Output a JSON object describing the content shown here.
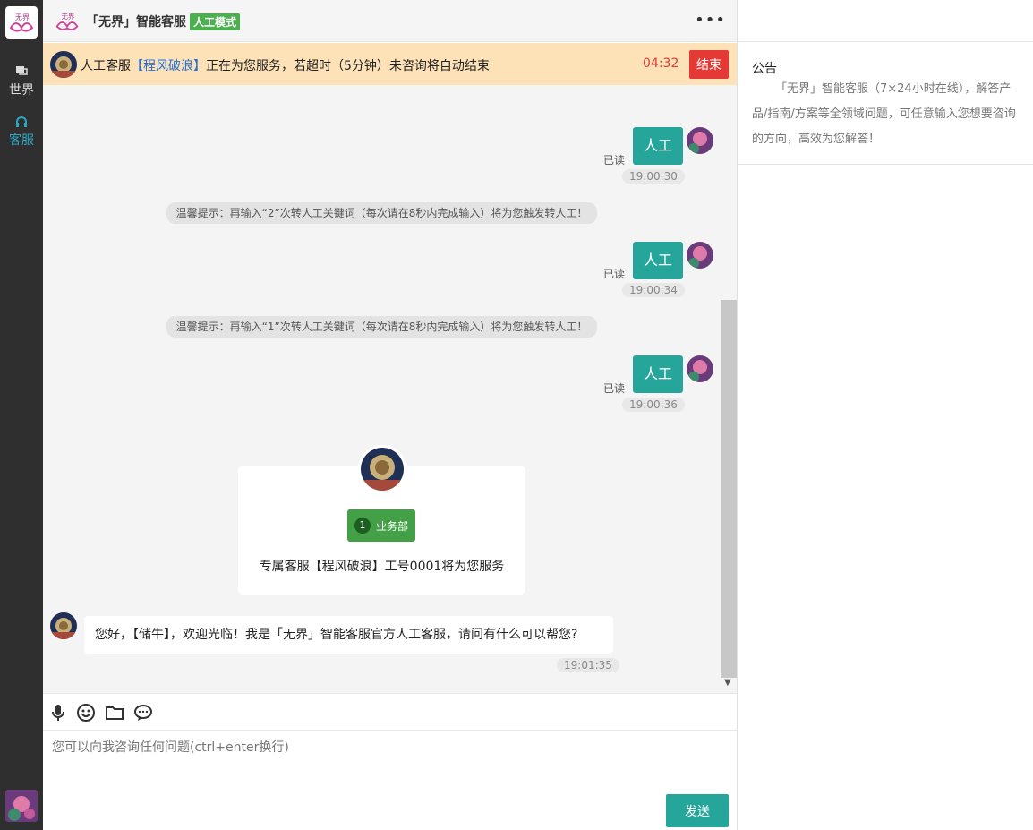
{
  "rail": {
    "nav": [
      {
        "label": "世界",
        "icon": "chat-bubbles-icon"
      },
      {
        "label": "客服",
        "icon": "headset-icon",
        "active": true
      }
    ]
  },
  "header": {
    "title": "「无界」智能客服",
    "mode_badge": "人工模式",
    "more": "•••"
  },
  "banner": {
    "prefix": "人工客服",
    "agent": "【程风破浪】",
    "suffix": "正在为您服务，若超时（5分钟）未咨询将自动结束",
    "timer": "04:32",
    "end_label": "结束"
  },
  "messages": {
    "out1": {
      "text": "人工",
      "read": "已读",
      "time": "19:00:30"
    },
    "tip1": "温馨提示：再输入“2”次转人工关键词（每次请在8秒内完成输入）将为您触发转人工！",
    "out2": {
      "text": "人工",
      "read": "已读",
      "time": "19:00:34"
    },
    "tip2": "温馨提示：再输入“1”次转人工关键词（每次请在8秒内完成输入）将为您触发转人工！",
    "out3": {
      "text": "人工",
      "read": "已读",
      "time": "19:00:36"
    },
    "card": {
      "dept_num": "1",
      "dept": "业务部",
      "desc": "专属客服【程风破浪】工号0001将为您服务"
    },
    "in1": {
      "text": "您好，【储牛】，欢迎光临！我是「无界」智能客服官方人工客服，请问有什么可以帮您?",
      "time": "19:01:35"
    }
  },
  "input": {
    "placeholder": "您可以向我咨询任何问题(ctrl+enter换行)",
    "send_label": "发送",
    "tools": [
      "microphone-icon",
      "emoji-icon",
      "folder-icon",
      "speech-bubble-icon"
    ]
  },
  "right": {
    "ann_title": "公告",
    "ann_body": "「无界」智能客服（7×24小时在线），解答产品/指南/方案等全领域问题，可任意输入您想要咨询的方向，高效为您解答！"
  },
  "colors": {
    "accent": "#26a69a",
    "danger": "#e53935",
    "banner": "#fde1b7",
    "rail": "#2f2f2f"
  }
}
